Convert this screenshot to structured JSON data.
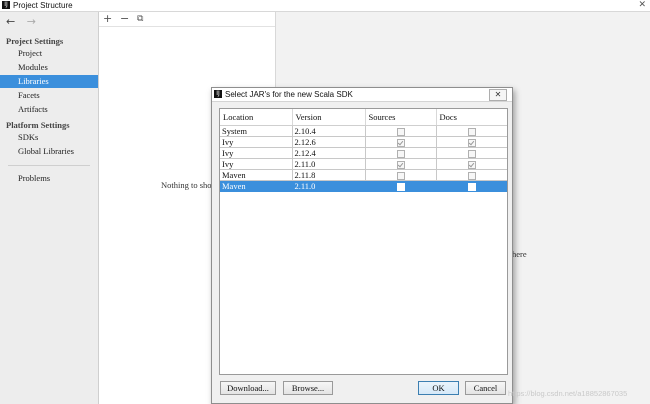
{
  "window": {
    "title": "Project Structure",
    "close": "✕"
  },
  "nav": {
    "back": "←",
    "forward": "→"
  },
  "sidebar": {
    "project_settings": "Project Settings",
    "items_top": [
      "Project",
      "Modules",
      "Libraries",
      "Facets",
      "Artifacts"
    ],
    "platform_settings": "Platform Settings",
    "items_platform": [
      "SDKs",
      "Global Libraries"
    ],
    "problems": "Problems",
    "selected": "Libraries"
  },
  "middle": {
    "add": "+",
    "remove": "−",
    "copy": "⧉",
    "empty_text": "Nothing to show",
    "right_hint": "here"
  },
  "dialog": {
    "title": "Select JAR's for the new Scala SDK",
    "close": "✕",
    "columns": [
      "Location",
      "Version",
      "Sources",
      "Docs"
    ],
    "rows": [
      {
        "location": "System",
        "version": "2.10.4",
        "sources": false,
        "docs": false
      },
      {
        "location": "Ivy",
        "version": "2.12.6",
        "sources": true,
        "docs": true
      },
      {
        "location": "Ivy",
        "version": "2.12.4",
        "sources": false,
        "docs": false
      },
      {
        "location": "Ivy",
        "version": "2.11.0",
        "sources": true,
        "docs": true
      },
      {
        "location": "Maven",
        "version": "2.11.8",
        "sources": false,
        "docs": false
      },
      {
        "location": "Maven",
        "version": "2.11.0",
        "sources": false,
        "docs": false,
        "selected": true
      }
    ],
    "buttons": {
      "download": "Download...",
      "browse": "Browse...",
      "ok": "OK",
      "cancel": "Cancel"
    }
  },
  "watermark": "https://blog.csdn.net/a18852867035"
}
